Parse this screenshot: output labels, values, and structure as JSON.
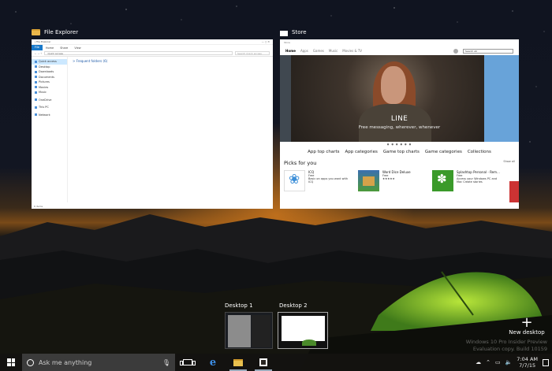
{
  "windows": [
    {
      "title": "File Explorer",
      "icon": "folder-icon"
    },
    {
      "title": "Store",
      "icon": "store-bag-icon"
    }
  ],
  "file_explorer": {
    "title_bar": "| File Explorer",
    "ribbon_tabs": [
      "File",
      "Home",
      "Share",
      "View"
    ],
    "address": "Quick access",
    "search_placeholder": "Search Quick access",
    "nav_items": [
      {
        "label": "Quick access",
        "pin": "★"
      },
      {
        "label": "Desktop",
        "pin": "•"
      },
      {
        "label": "Downloads",
        "pin": "•"
      },
      {
        "label": "Documents",
        "pin": "•"
      },
      {
        "label": "Pictures",
        "pin": "•"
      },
      {
        "label": "Movies",
        "pin": ""
      },
      {
        "label": "Music",
        "pin": ""
      },
      {
        "label": "OneDrive",
        "pin": ""
      },
      {
        "label": "This PC",
        "pin": ""
      },
      {
        "label": "Network",
        "pin": ""
      }
    ],
    "main_text": "> Frequent folders (6)",
    "status": "6 items"
  },
  "store": {
    "title_bar": "Store",
    "nav": [
      "Home",
      "Apps",
      "Games",
      "Music",
      "Movies & TV"
    ],
    "search_value": "Search All",
    "hero_title": "LINE",
    "hero_subtitle": "Free messaging, wherever, whenever",
    "dots": "● ● ● ● ● ●",
    "categories": [
      "App top charts",
      "App categories",
      "Game top charts",
      "Game categories",
      "Collections"
    ],
    "picks_title": "Picks for you",
    "show_all": "Show all",
    "apps": [
      {
        "name": "ICQ",
        "publisher": "Free",
        "desc": "Basic on apps you want with ICQ",
        "icon": "icq-flower-icon"
      },
      {
        "name": "Word Dice Deluxe",
        "publisher": "Free",
        "desc": "★★★★★",
        "icon": "word-dice-icon"
      },
      {
        "name": "Splashtop Personal - Rem...",
        "publisher": "Free",
        "desc": "Access your Windows PC and Mac Create stories",
        "icon": "splashtop-icon"
      }
    ]
  },
  "desktops": [
    {
      "label": "Desktop 1"
    },
    {
      "label": "Desktop 2"
    }
  ],
  "new_desktop": {
    "plus": "+",
    "label": "New desktop"
  },
  "watermark": {
    "line1": "Windows 10 Pro Insider Preview",
    "line2": "Evaluation copy. Build 10159"
  },
  "taskbar": {
    "search_placeholder": "Ask me anything",
    "pinned": [
      "task-view-icon",
      "edge-icon",
      "file-explorer-icon",
      "store-icon"
    ],
    "tray_icons": [
      "onedrive-icon",
      "chevron-up-icon",
      "network-icon",
      "volume-icon"
    ],
    "time": "7:04 AM",
    "date": "7/7/15"
  },
  "colors": {
    "accent": "#1979ca",
    "taskbar": "#141210",
    "search_box": "#3b3b3b"
  }
}
